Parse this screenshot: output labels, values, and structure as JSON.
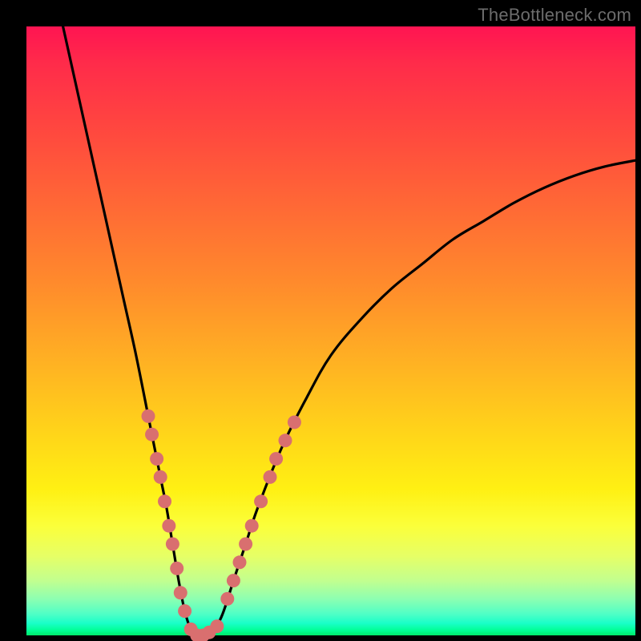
{
  "watermark": "TheBottleneck.com",
  "colors": {
    "frame": "#000000",
    "curve_stroke": "#000000",
    "dot_fill": "#d96f6f",
    "gradient_top": "#ff1452",
    "gradient_bottom": "#00e86a"
  },
  "chart_data": {
    "type": "line",
    "title": "",
    "xlabel": "",
    "ylabel": "",
    "xlim": [
      0,
      100
    ],
    "ylim": [
      0,
      100
    ],
    "annotations": [
      "TheBottleneck.com"
    ],
    "series": [
      {
        "name": "bottleneck-curve",
        "x": [
          6,
          8,
          10,
          12,
          14,
          16,
          18,
          20,
          21,
          22,
          23,
          24,
          25,
          26,
          27,
          28,
          30,
          32,
          34,
          36,
          38,
          42,
          46,
          50,
          55,
          60,
          65,
          70,
          75,
          80,
          85,
          90,
          95,
          100
        ],
        "y": [
          100,
          91,
          82,
          73,
          64,
          55,
          46,
          36,
          31,
          26,
          21,
          15,
          9,
          4,
          1,
          0,
          0,
          3,
          9,
          15,
          21,
          31,
          39,
          46,
          52,
          57,
          61,
          65,
          68,
          71,
          73.5,
          75.5,
          77,
          78
        ]
      }
    ],
    "highlight_dots": {
      "name": "sample-points",
      "points": [
        {
          "x": 20.0,
          "y": 36
        },
        {
          "x": 20.6,
          "y": 33
        },
        {
          "x": 21.4,
          "y": 29
        },
        {
          "x": 22.0,
          "y": 26
        },
        {
          "x": 22.7,
          "y": 22
        },
        {
          "x": 23.4,
          "y": 18
        },
        {
          "x": 24.0,
          "y": 15
        },
        {
          "x": 24.7,
          "y": 11
        },
        {
          "x": 25.3,
          "y": 7
        },
        {
          "x": 26.0,
          "y": 4
        },
        {
          "x": 27.0,
          "y": 1
        },
        {
          "x": 28.0,
          "y": 0
        },
        {
          "x": 29.0,
          "y": 0
        },
        {
          "x": 30.0,
          "y": 0.5
        },
        {
          "x": 31.3,
          "y": 1.5
        },
        {
          "x": 33.0,
          "y": 6
        },
        {
          "x": 34.0,
          "y": 9
        },
        {
          "x": 35.0,
          "y": 12
        },
        {
          "x": 36.0,
          "y": 15
        },
        {
          "x": 37.0,
          "y": 18
        },
        {
          "x": 38.5,
          "y": 22
        },
        {
          "x": 40.0,
          "y": 26
        },
        {
          "x": 41.0,
          "y": 29
        },
        {
          "x": 42.5,
          "y": 32
        },
        {
          "x": 44.0,
          "y": 35
        }
      ]
    }
  }
}
